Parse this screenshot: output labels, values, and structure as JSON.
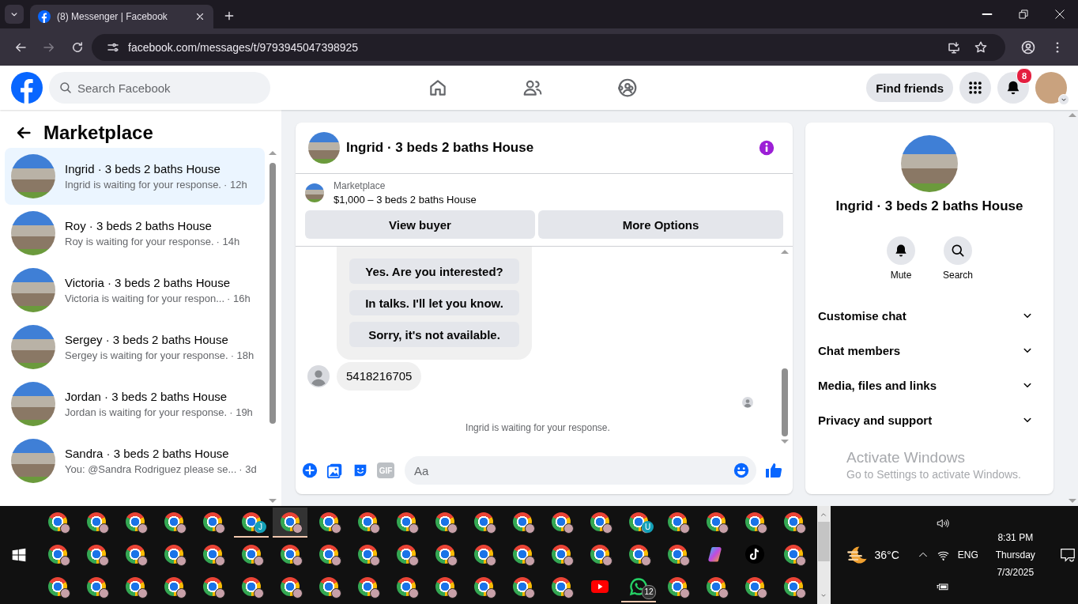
{
  "browser": {
    "tab_title": "(8) Messenger | Facebook",
    "url": "facebook.com/messages/t/9793945047398925"
  },
  "header": {
    "search_placeholder": "Search Facebook",
    "nav": [
      {
        "kind": "home"
      },
      {
        "kind": "friends"
      },
      {
        "kind": "groups"
      }
    ],
    "find_friends": "Find friends",
    "notification_count": "8"
  },
  "sidebar": {
    "title": "Marketplace",
    "conversations": [
      {
        "name": "Ingrid · 3 beds 2 baths House",
        "preview": "Ingrid is waiting for your response.",
        "time": "· 12h",
        "selected": true
      },
      {
        "name": "Roy · 3 beds 2 baths House",
        "preview": "Roy is waiting for your response.",
        "time": "· 14h",
        "selected": false
      },
      {
        "name": "Victoria · 3 beds 2 baths House",
        "preview": "Victoria is waiting for your respon...",
        "time": "· 16h",
        "selected": false
      },
      {
        "name": "Sergey · 3 beds 2 baths House",
        "preview": "Sergey is waiting for your response.",
        "time": "· 18h",
        "selected": false
      },
      {
        "name": "Jordan · 3 beds 2 baths House",
        "preview": "Jordan is waiting for your response.",
        "time": "· 19h",
        "selected": false
      },
      {
        "name": "Sandra · 3 beds 2 baths House",
        "preview": "You: @Sandra Rodriguez please se...",
        "time": "· 3d",
        "selected": false
      }
    ]
  },
  "chat": {
    "title": "Ingrid · 3 beds 2 baths House",
    "listing": {
      "source": "Marketplace",
      "summary": "$1,000 – 3 beds 2 baths House"
    },
    "actions": [
      "View buyer",
      "More Options"
    ],
    "quick_replies": [
      "Yes. Are you interested?",
      "In talks. I'll let you know.",
      "Sorry, it's not available."
    ],
    "messages": [
      {
        "text": "5418216705"
      }
    ],
    "status": "Ingrid is waiting for your response.",
    "composer": {
      "gif_label": "GIF",
      "placeholder": "Aa"
    }
  },
  "details": {
    "title": "Ingrid · 3 beds 2 baths House",
    "actions": [
      {
        "kind": "mute",
        "label": "Mute"
      },
      {
        "kind": "search",
        "label": "Search"
      }
    ],
    "sections": [
      {
        "label": "Customise chat",
        "expanded": false
      },
      {
        "label": "Chat members",
        "expanded": false
      },
      {
        "label": "Media, files and links",
        "expanded": false
      },
      {
        "label": "Privacy and support",
        "expanded": false
      }
    ]
  },
  "activation_notice": {
    "title": "Activate Windows",
    "text": "Go to Settings to activate Windows."
  },
  "taskbar": {
    "rows": [
      [
        {
          "kind": "chrome",
          "running": false,
          "selected": false
        },
        {
          "kind": "chrome",
          "running": false,
          "selected": false
        },
        {
          "kind": "chrome",
          "running": false,
          "selected": false
        },
        {
          "kind": "chrome",
          "running": false,
          "selected": false
        },
        {
          "kind": "chrome",
          "running": false,
          "selected": false
        },
        {
          "kind": "chrome",
          "running": true,
          "selected": false,
          "badge": "J"
        },
        {
          "kind": "chrome",
          "running": true,
          "selected": true
        },
        {
          "kind": "chrome",
          "running": false,
          "selected": false
        },
        {
          "kind": "chrome",
          "running": false,
          "selected": false
        },
        {
          "kind": "chrome",
          "running": false,
          "selected": false
        },
        {
          "kind": "chrome",
          "running": false,
          "selected": false
        },
        {
          "kind": "chrome",
          "running": false,
          "selected": false
        },
        {
          "kind": "chrome",
          "running": false,
          "selected": false
        },
        {
          "kind": "chrome",
          "running": false,
          "selected": false
        },
        {
          "kind": "chrome",
          "running": false,
          "selected": false
        },
        {
          "kind": "chrome",
          "running": false,
          "selected": false,
          "badge": "U"
        },
        {
          "kind": "chrome",
          "running": false,
          "selected": false
        },
        {
          "kind": "chrome",
          "running": false,
          "selected": false
        },
        {
          "kind": "chrome",
          "running": false,
          "selected": false
        },
        {
          "kind": "chrome",
          "running": false,
          "selected": false
        }
      ],
      [
        {
          "kind": "chrome",
          "running": false,
          "selected": false
        },
        {
          "kind": "chrome",
          "running": false,
          "selected": false
        },
        {
          "kind": "chrome",
          "running": false,
          "selected": false
        },
        {
          "kind": "chrome",
          "running": false,
          "selected": false
        },
        {
          "kind": "chrome",
          "running": false,
          "selected": false
        },
        {
          "kind": "chrome",
          "running": false,
          "selected": false
        },
        {
          "kind": "chrome",
          "running": false,
          "selected": false
        },
        {
          "kind": "chrome",
          "running": false,
          "selected": false
        },
        {
          "kind": "chrome",
          "running": false,
          "selected": false
        },
        {
          "kind": "chrome",
          "running": false,
          "selected": false
        },
        {
          "kind": "chrome",
          "running": false,
          "selected": false
        },
        {
          "kind": "chrome",
          "running": false,
          "selected": false
        },
        {
          "kind": "chrome",
          "running": false,
          "selected": false
        },
        {
          "kind": "chrome",
          "running": false,
          "selected": false
        },
        {
          "kind": "chrome",
          "running": false,
          "selected": false
        },
        {
          "kind": "chrome",
          "running": false,
          "selected": false
        },
        {
          "kind": "chrome",
          "running": false,
          "selected": false
        },
        {
          "kind": "copilot",
          "running": false,
          "selected": false
        },
        {
          "kind": "tiktok",
          "running": false,
          "selected": false
        },
        {
          "kind": "chrome",
          "running": false,
          "selected": false
        }
      ],
      [
        {
          "kind": "chrome",
          "running": false,
          "selected": false
        },
        {
          "kind": "chrome",
          "running": false,
          "selected": false
        },
        {
          "kind": "chrome",
          "running": false,
          "selected": false
        },
        {
          "kind": "chrome",
          "running": false,
          "selected": false
        },
        {
          "kind": "chrome",
          "running": false,
          "selected": false
        },
        {
          "kind": "chrome",
          "running": false,
          "selected": false
        },
        {
          "kind": "chrome",
          "running": false,
          "selected": false
        },
        {
          "kind": "chrome",
          "running": false,
          "selected": false
        },
        {
          "kind": "chrome",
          "running": false,
          "selected": false
        },
        {
          "kind": "chrome",
          "running": false,
          "selected": false
        },
        {
          "kind": "chrome",
          "running": false,
          "selected": false
        },
        {
          "kind": "chrome",
          "running": false,
          "selected": false
        },
        {
          "kind": "chrome",
          "running": false,
          "selected": false
        },
        {
          "kind": "chrome",
          "running": false,
          "selected": false
        },
        {
          "kind": "youtube",
          "running": false,
          "selected": false
        },
        {
          "kind": "whatsapp",
          "running": true,
          "selected": false,
          "badge": "12"
        },
        {
          "kind": "chrome",
          "running": false,
          "selected": false
        },
        {
          "kind": "chrome",
          "running": false,
          "selected": false
        },
        {
          "kind": "chrome",
          "running": false,
          "selected": false
        },
        {
          "kind": "chrome",
          "running": false,
          "selected": false
        }
      ]
    ],
    "tray": {
      "temperature": "36°C",
      "language": "ENG",
      "time": "8:31 PM",
      "day": "Thursday",
      "date": "7/3/2025"
    }
  }
}
